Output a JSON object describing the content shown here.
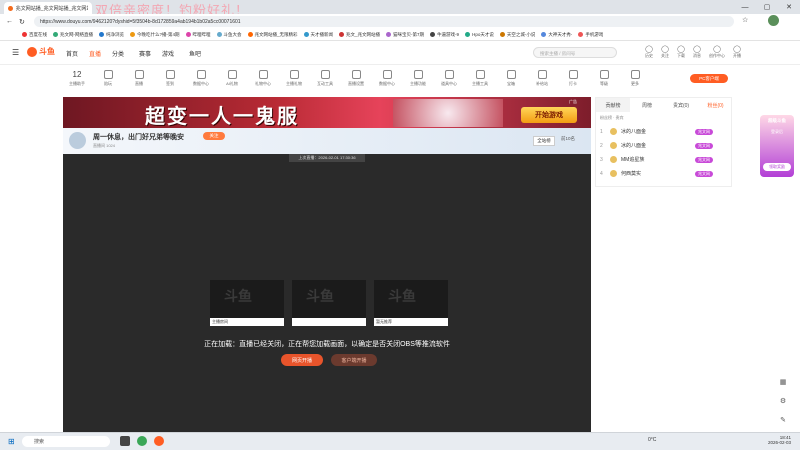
{
  "browser": {
    "tab_title": "兆文网站播_兆文网站播_兆文网站",
    "overlay_text": "双倍亲密度！钓粉好礼！",
    "url": "https://www.douyu.com/9462120?dyshid=5f3504b-8d172859a4ab194b1b02a5cc00071601"
  },
  "bookmarks": [
    "百度在线",
    "兆文网-网络直播",
    "纯净浏览",
    "今晚吃什么?播-第4期",
    "哔哩哔哩",
    "斗鱼大会",
    "兆文网站播_无限精彩",
    "天才播新闻",
    "兆文_兆文网站播",
    "猫咪宝贝-第7期",
    "牛逼游戏-9",
    "Hpo天才说",
    "天空之城-小说",
    "大神天才秀-",
    "手机游戏"
  ],
  "site": {
    "logo": "斗鱼",
    "nav": [
      "首页",
      "直播",
      "分类",
      "赛事",
      "游戏",
      "鱼吧"
    ],
    "search_placeholder": "搜索主播 / 房间号",
    "user_icons": [
      "历史",
      "关注",
      "下载",
      "消息",
      "创作中心",
      "开播"
    ]
  },
  "categories": [
    {
      "label": "12",
      "sub": "主播助手"
    },
    {
      "label": "陪玩"
    },
    {
      "label": "直播"
    },
    {
      "label": "签到"
    },
    {
      "label": "数据中心"
    },
    {
      "label": "AI礼物"
    },
    {
      "label": "礼物中心"
    },
    {
      "label": "主播礼物"
    },
    {
      "label": "互动工具"
    },
    {
      "label": "直播设置"
    },
    {
      "label": "数据中心"
    },
    {
      "label": "主播功能"
    },
    {
      "label": "道具中心"
    },
    {
      "label": "主播工具"
    },
    {
      "label": "宝箱"
    },
    {
      "label": "补给站"
    },
    {
      "label": "打卡"
    },
    {
      "label": "等级"
    },
    {
      "label": "更多"
    }
  ],
  "pc_button": "PC客户端",
  "promo": {
    "title": "超变一人一鬼服",
    "button": "开始游戏",
    "ad_tag": "广告"
  },
  "room": {
    "title": "周一休息，出门好兄弟等晚安",
    "tag": "关注",
    "stats": "直播间 1024",
    "grade": "全站榜",
    "rank": "前10名"
  },
  "video": {
    "prev_time": "上次直播：2026-02-01 17:30:36",
    "status": "正在加载：直播已经关闭，正在帮您加载画面，以确定是否关闭OBS等推流软件",
    "btn1": "网页开播",
    "btn2": "客户端开播",
    "watermark": "斗鱼",
    "card_labels": [
      "主播房间",
      "",
      "暂无推荐"
    ]
  },
  "right_panel": {
    "tabs": [
      "贡献榜",
      "周榜",
      "贵宾(0)",
      "粉丝(0)"
    ],
    "header": "粉丝榜 · 贵宾",
    "rows": [
      {
        "rank": "1",
        "name": "冰的八面金",
        "badge": "兆文网"
      },
      {
        "rank": "2",
        "name": "冰的八面金",
        "badge": "兆文网"
      },
      {
        "rank": "3",
        "name": "MM追星族",
        "badge": "兆文网"
      },
      {
        "rank": "4",
        "name": "何西莫实",
        "badge": "兆文网"
      }
    ]
  },
  "floating": {
    "title": "超级斗鱼",
    "sub": "登录后",
    "btn": "领取奖励"
  },
  "taskbar": {
    "search": "搜索",
    "weather": "0°C",
    "time": "18:41",
    "date": "2026-02-03"
  }
}
